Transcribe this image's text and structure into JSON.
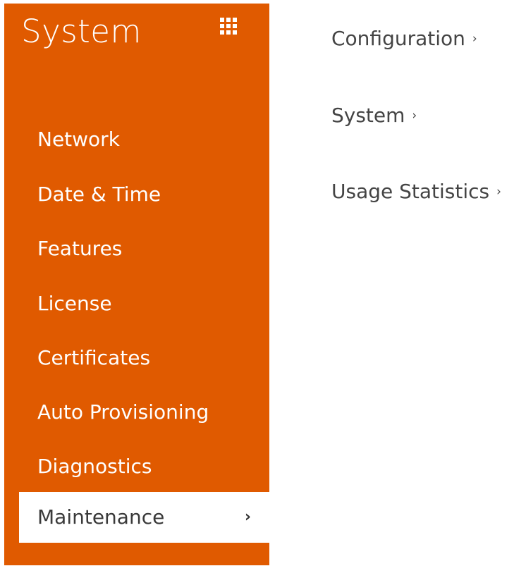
{
  "sidebar": {
    "title": "System",
    "grid_icon": "grid-icon",
    "items": [
      {
        "label": "Network"
      },
      {
        "label": "Date & Time"
      },
      {
        "label": "Features"
      },
      {
        "label": "License"
      },
      {
        "label": "Certificates"
      },
      {
        "label": "Auto Provisioning"
      },
      {
        "label": "Diagnostics"
      },
      {
        "label": "Maintenance",
        "active": true,
        "chevron": "›"
      }
    ]
  },
  "main": {
    "links": [
      {
        "label": "Configuration",
        "chevron": "›"
      },
      {
        "label": "System",
        "chevron": "›"
      },
      {
        "label": "Usage Statistics",
        "chevron": "›"
      }
    ]
  },
  "colors": {
    "sidebar_bg": "#e05a00",
    "active_bg": "#ffffff",
    "text_light": "#ffffff",
    "text_dark": "#444444"
  }
}
